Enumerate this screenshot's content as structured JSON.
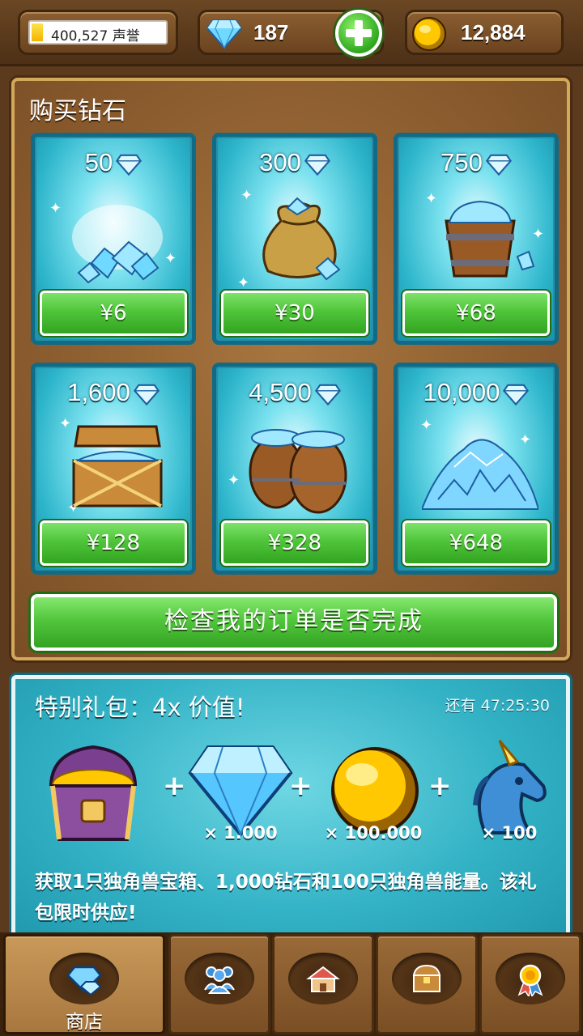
{
  "top_bar": {
    "reputation": "400,527 声誉",
    "gems": "187",
    "coins": "12,884"
  },
  "shop": {
    "title": "购买钻石",
    "packs": [
      {
        "amount": "50",
        "price": "¥6",
        "icon": "gem-pile-icon"
      },
      {
        "amount": "300",
        "price": "¥30",
        "icon": "gem-sack-icon"
      },
      {
        "amount": "750",
        "price": "¥68",
        "icon": "gem-bucket-icon"
      },
      {
        "amount": "1,600",
        "price": "¥128",
        "icon": "gem-chest-icon"
      },
      {
        "amount": "4,500",
        "price": "¥328",
        "icon": "gem-barrels-icon"
      },
      {
        "amount": "10,000",
        "price": "¥648",
        "icon": "gem-mountain-icon"
      }
    ],
    "check_orders": "检查我的订单是否完成"
  },
  "offer": {
    "title": "特别礼包：4x 价值!",
    "timer": "还有 47:25:30",
    "items": [
      {
        "icon": "treasure-chest-icon",
        "qty": ""
      },
      {
        "icon": "diamond-icon",
        "qty": "× 1.000"
      },
      {
        "icon": "gold-coin-icon",
        "qty": "× 100.000"
      },
      {
        "icon": "unicorn-icon",
        "qty": "× 100"
      }
    ],
    "description": "获取1只独角兽宝箱、1,000钻石和100只独角兽能量。该礼包限时供应!"
  },
  "nav": {
    "tabs": [
      {
        "label": "商店",
        "icon": "shop-diamond-icon",
        "active": true
      },
      {
        "label": "",
        "icon": "people-icon"
      },
      {
        "label": "",
        "icon": "buildings-icon"
      },
      {
        "label": "",
        "icon": "treasure-icon"
      },
      {
        "label": "",
        "icon": "medal-icon"
      }
    ]
  },
  "colors": {
    "accent_green": "#4fc53a",
    "card_teal": "#2db5cb",
    "wood": "#8c5d2f"
  }
}
